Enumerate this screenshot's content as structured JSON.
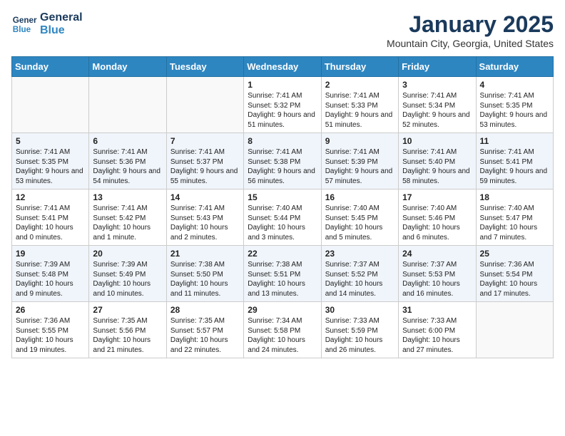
{
  "header": {
    "logo_line1": "General",
    "logo_line2": "Blue",
    "month_title": "January 2025",
    "location": "Mountain City, Georgia, United States"
  },
  "weekdays": [
    "Sunday",
    "Monday",
    "Tuesday",
    "Wednesday",
    "Thursday",
    "Friday",
    "Saturday"
  ],
  "weeks": [
    [
      {
        "day": "",
        "info": ""
      },
      {
        "day": "",
        "info": ""
      },
      {
        "day": "",
        "info": ""
      },
      {
        "day": "1",
        "info": "Sunrise: 7:41 AM\nSunset: 5:32 PM\nDaylight: 9 hours and 51 minutes."
      },
      {
        "day": "2",
        "info": "Sunrise: 7:41 AM\nSunset: 5:33 PM\nDaylight: 9 hours and 51 minutes."
      },
      {
        "day": "3",
        "info": "Sunrise: 7:41 AM\nSunset: 5:34 PM\nDaylight: 9 hours and 52 minutes."
      },
      {
        "day": "4",
        "info": "Sunrise: 7:41 AM\nSunset: 5:35 PM\nDaylight: 9 hours and 53 minutes."
      }
    ],
    [
      {
        "day": "5",
        "info": "Sunrise: 7:41 AM\nSunset: 5:35 PM\nDaylight: 9 hours and 53 minutes."
      },
      {
        "day": "6",
        "info": "Sunrise: 7:41 AM\nSunset: 5:36 PM\nDaylight: 9 hours and 54 minutes."
      },
      {
        "day": "7",
        "info": "Sunrise: 7:41 AM\nSunset: 5:37 PM\nDaylight: 9 hours and 55 minutes."
      },
      {
        "day": "8",
        "info": "Sunrise: 7:41 AM\nSunset: 5:38 PM\nDaylight: 9 hours and 56 minutes."
      },
      {
        "day": "9",
        "info": "Sunrise: 7:41 AM\nSunset: 5:39 PM\nDaylight: 9 hours and 57 minutes."
      },
      {
        "day": "10",
        "info": "Sunrise: 7:41 AM\nSunset: 5:40 PM\nDaylight: 9 hours and 58 minutes."
      },
      {
        "day": "11",
        "info": "Sunrise: 7:41 AM\nSunset: 5:41 PM\nDaylight: 9 hours and 59 minutes."
      }
    ],
    [
      {
        "day": "12",
        "info": "Sunrise: 7:41 AM\nSunset: 5:41 PM\nDaylight: 10 hours and 0 minutes."
      },
      {
        "day": "13",
        "info": "Sunrise: 7:41 AM\nSunset: 5:42 PM\nDaylight: 10 hours and 1 minute."
      },
      {
        "day": "14",
        "info": "Sunrise: 7:41 AM\nSunset: 5:43 PM\nDaylight: 10 hours and 2 minutes."
      },
      {
        "day": "15",
        "info": "Sunrise: 7:40 AM\nSunset: 5:44 PM\nDaylight: 10 hours and 3 minutes."
      },
      {
        "day": "16",
        "info": "Sunrise: 7:40 AM\nSunset: 5:45 PM\nDaylight: 10 hours and 5 minutes."
      },
      {
        "day": "17",
        "info": "Sunrise: 7:40 AM\nSunset: 5:46 PM\nDaylight: 10 hours and 6 minutes."
      },
      {
        "day": "18",
        "info": "Sunrise: 7:40 AM\nSunset: 5:47 PM\nDaylight: 10 hours and 7 minutes."
      }
    ],
    [
      {
        "day": "19",
        "info": "Sunrise: 7:39 AM\nSunset: 5:48 PM\nDaylight: 10 hours and 9 minutes."
      },
      {
        "day": "20",
        "info": "Sunrise: 7:39 AM\nSunset: 5:49 PM\nDaylight: 10 hours and 10 minutes."
      },
      {
        "day": "21",
        "info": "Sunrise: 7:38 AM\nSunset: 5:50 PM\nDaylight: 10 hours and 11 minutes."
      },
      {
        "day": "22",
        "info": "Sunrise: 7:38 AM\nSunset: 5:51 PM\nDaylight: 10 hours and 13 minutes."
      },
      {
        "day": "23",
        "info": "Sunrise: 7:37 AM\nSunset: 5:52 PM\nDaylight: 10 hours and 14 minutes."
      },
      {
        "day": "24",
        "info": "Sunrise: 7:37 AM\nSunset: 5:53 PM\nDaylight: 10 hours and 16 minutes."
      },
      {
        "day": "25",
        "info": "Sunrise: 7:36 AM\nSunset: 5:54 PM\nDaylight: 10 hours and 17 minutes."
      }
    ],
    [
      {
        "day": "26",
        "info": "Sunrise: 7:36 AM\nSunset: 5:55 PM\nDaylight: 10 hours and 19 minutes."
      },
      {
        "day": "27",
        "info": "Sunrise: 7:35 AM\nSunset: 5:56 PM\nDaylight: 10 hours and 21 minutes."
      },
      {
        "day": "28",
        "info": "Sunrise: 7:35 AM\nSunset: 5:57 PM\nDaylight: 10 hours and 22 minutes."
      },
      {
        "day": "29",
        "info": "Sunrise: 7:34 AM\nSunset: 5:58 PM\nDaylight: 10 hours and 24 minutes."
      },
      {
        "day": "30",
        "info": "Sunrise: 7:33 AM\nSunset: 5:59 PM\nDaylight: 10 hours and 26 minutes."
      },
      {
        "day": "31",
        "info": "Sunrise: 7:33 AM\nSunset: 6:00 PM\nDaylight: 10 hours and 27 minutes."
      },
      {
        "day": "",
        "info": ""
      }
    ]
  ]
}
